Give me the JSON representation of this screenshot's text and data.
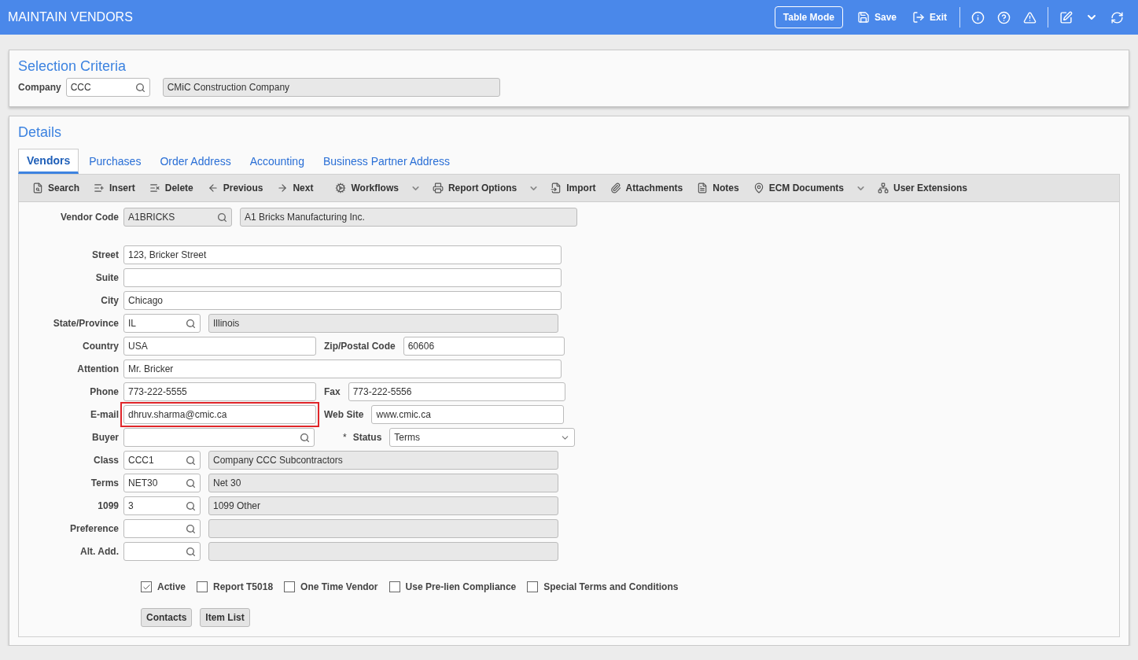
{
  "header": {
    "title": "MAINTAIN VENDORS",
    "table_mode": "Table Mode",
    "save": "Save",
    "exit": "Exit"
  },
  "selection": {
    "title": "Selection Criteria",
    "label": "Company",
    "value": "CCC",
    "description": "CMiC Construction Company"
  },
  "details": {
    "title": "Details",
    "tabs": [
      {
        "label": "Vendors",
        "selected": true
      },
      {
        "label": "Purchases",
        "selected": false
      },
      {
        "label": "Order Address",
        "selected": false
      },
      {
        "label": "Accounting",
        "selected": false
      },
      {
        "label": "Business Partner Address",
        "selected": false
      }
    ],
    "toolbar": [
      {
        "label": "Search",
        "dropdown": false
      },
      {
        "label": "Insert",
        "dropdown": false
      },
      {
        "label": "Delete",
        "dropdown": false
      },
      {
        "label": "Previous",
        "dropdown": false
      },
      {
        "label": "Next",
        "dropdown": false
      },
      {
        "label": "Workflows",
        "dropdown": true
      },
      {
        "label": "Report Options",
        "dropdown": true
      },
      {
        "label": "Import",
        "dropdown": false
      },
      {
        "label": "Attachments",
        "dropdown": false
      },
      {
        "label": "Notes",
        "dropdown": false
      },
      {
        "label": "ECM Documents",
        "dropdown": true
      },
      {
        "label": "User Extensions",
        "dropdown": false
      }
    ],
    "vendor_code": {
      "label": "Vendor Code",
      "value": "A1BRICKS",
      "description": "A1 Bricks Manufacturing Inc."
    },
    "rows": [
      {
        "kind": "text",
        "label": "Street",
        "value": "123, Bricker Street"
      },
      {
        "kind": "text",
        "label": "Suite"
      },
      {
        "kind": "text",
        "label": "City",
        "value": "Chicago"
      },
      {
        "kind": "lookup",
        "label": "State/Province",
        "value": "IL",
        "description": "Illinois"
      },
      {
        "kind": "pair",
        "label": "Country",
        "value": "USA",
        "label2": "Zip/Postal Code",
        "value2": "60606",
        "highlighted": false
      },
      {
        "kind": "text",
        "label": "Attention",
        "value": "Mr. Bricker"
      },
      {
        "kind": "pair",
        "label": "Phone",
        "value": "773-222-5555",
        "label2": "Fax",
        "value2": "773-222-5556",
        "highlighted": false
      },
      {
        "kind": "pair",
        "label": "E-mail",
        "value": "dhruv.sharma@cmic.ca",
        "label2": "Web Site",
        "value2": "www.cmic.ca",
        "highlighted": true
      },
      {
        "kind": "status",
        "label": "Buyer",
        "mark": "*",
        "label2": "Status",
        "value2": "Terms"
      },
      {
        "kind": "lookup",
        "label": "Class",
        "value": "CCC1",
        "description": "Company CCC Subcontractors"
      },
      {
        "kind": "lookup",
        "label": "Terms",
        "value": "NET30",
        "description": "Net 30"
      },
      {
        "kind": "lookup",
        "label": "1099",
        "value": "3",
        "description": "1099 Other"
      },
      {
        "kind": "lookup",
        "label": "Preference"
      },
      {
        "kind": "lookup",
        "label": "Alt. Add."
      }
    ],
    "checkboxes": [
      {
        "label": "Active",
        "checked": true
      },
      {
        "label": "Report T5018",
        "checked": false
      },
      {
        "label": "One Time Vendor",
        "checked": false
      },
      {
        "label": "Use Pre-lien Compliance",
        "checked": false
      },
      {
        "label": "Special Terms and Conditions",
        "checked": false
      }
    ],
    "buttons": [
      "Contacts",
      "Item List"
    ]
  }
}
